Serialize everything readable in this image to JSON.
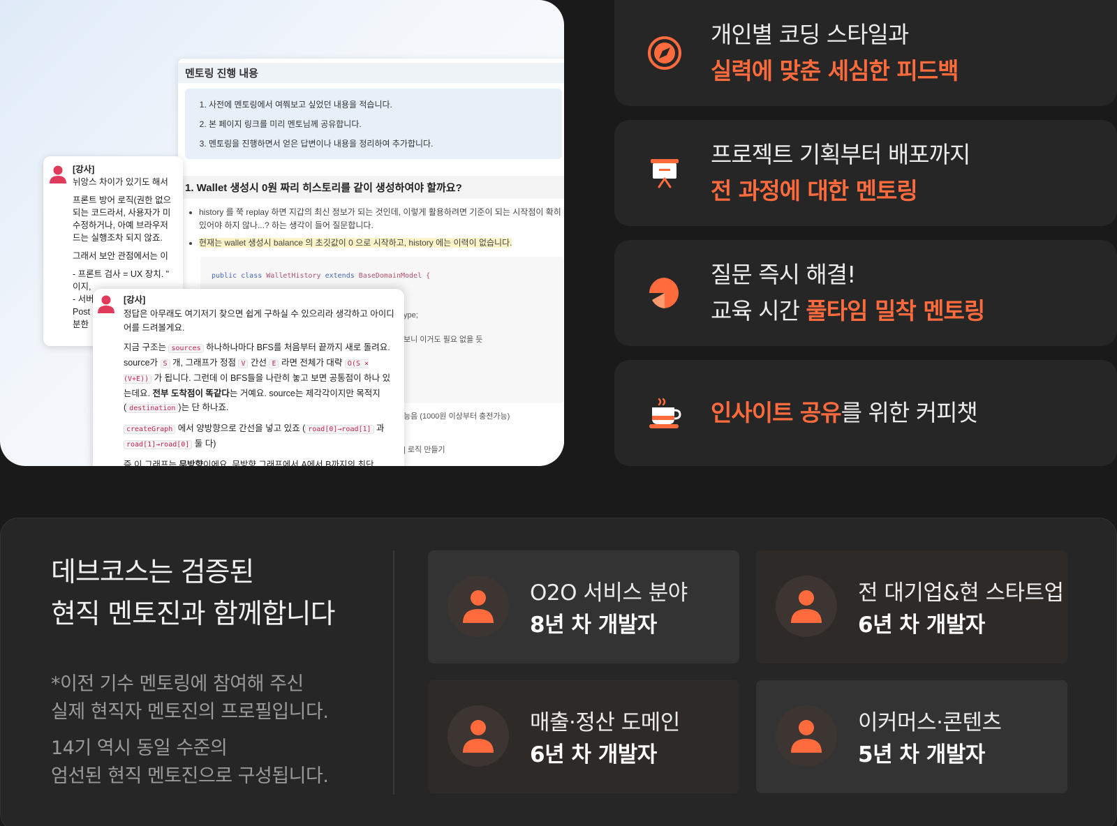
{
  "collage": {
    "doc_title": "멘토링 진행 내용",
    "steps": [
      "사전에 멘토링에서 여쭤보고 싶었던 내용을 적습니다.",
      "본 페이지 링크를 미리 멘토님께 공유합니다.",
      "멘토링을 진행하면서 얻은 답변이나 내용을 정리하여 추가합니다."
    ],
    "question": "1. Wallet 생성시 0원 짜리 히스토리를 같이 생성하여야 할까요?",
    "bullet1": "history 를 쭉 replay 하면 지갑의 최신 정보가 되는 것인데, 이렇게 활용하려면 기준이 되는 시작점이 확히 있어야 하지 않나...? 하는 생각이 들어 질문합니다.",
    "bullet2": "현재는 wallet 생성시 balance 의 초깃값이 0 으로 시작하고, history 에는 이력이 없습니다.",
    "code_kw1": "public class",
    "code_cls1": "WalletHistory",
    "code_kw2": "extends",
    "code_cls2": "BaseDomainModel {",
    "frag1": "ype;",
    "frag2": "보니 이거도 필요 없을 듯",
    "frag3": "능음 (1000원 이상부터 충전가능)",
    "frag4": "| 로직 만들기",
    "card1": {
      "role": "[강사]",
      "lines": [
        "뉘앙스 차이가 있기도 해서",
        "프론트 방어 로직(권한 없으",
        "되는 코드라서, 사용자가 미",
        "수정하거나, 아예 브라우저",
        "드는 실행조차 되지 않죠.",
        "그래서 보안 관점에서는 이",
        "- 프론트 검사 = UX 장치. \"",
        "이지,",
        "- 서버",
        "Post",
        "분한"
      ]
    },
    "card2": {
      "role": "[강사]",
      "intro": "정답은 아무래도 여기저기 찾으면 쉽게 구하실 수 있으리라 생각하고 아이디어를 드려볼게요.",
      "p1_a": "지금 구조는",
      "tok_sources": "sources",
      "p1_b": "하나하나마다 BFS를 처음부터 끝까지 새로 돌려요. source가",
      "tok_s": "S",
      "p1_c": "개, 그래프가 정점",
      "tok_v": "V",
      "p1_d": "간선",
      "tok_e": "E",
      "p1_e": "라면 전체가 대략",
      "tok_o": "O(S × (V+E))",
      "p1_f": "가 됩니다. 그런데 이 BFS들을 나란히 놓고 보면 공통점이 하나 있는데요.",
      "p1_bold": "전부 도착점이 똑같다",
      "p1_g": "는 거예요. source는 제각각이지만 목적지(",
      "tok_dest": "destination",
      "p1_h": ")는 단 하나죠.",
      "tok_cg": "createGraph",
      "p2_a": "에서 양방향으로 간선을 넣고 있죠 (",
      "tok_r1": "road[0]→road[1]",
      "p2_b": "과",
      "tok_r2": "road[1]→road[0]",
      "p2_c": "둘 다)",
      "p3_a": "즉 이 그래프는",
      "p3_bold": "무방향",
      "p3_b": "이에요. 무방향 그래프에서 A에서 B까지의 최단"
    }
  },
  "features": [
    {
      "icon": "compass-icon",
      "line1": "개인별 코딩 스타일과",
      "line2_orange": "실력에 맞춘 세심한 피드백",
      "line2_rest": ""
    },
    {
      "icon": "presentation-board-icon",
      "line1": "프로젝트 기획부터 배포까지",
      "line2_orange": "전 과정에 대한 멘토링",
      "line2_rest": ""
    },
    {
      "icon": "speech-bubble-icon",
      "line1": "질문 즉시 해결!",
      "line2_prefix": "교육 시간 ",
      "line2_orange": "풀타임 밀착 멘토링"
    },
    {
      "icon": "coffee-cup-icon",
      "line_orange": "인사이트 공유",
      "line_rest": "를 위한 커피챗"
    }
  ],
  "bottom": {
    "headline1": "데브코스는 검증된",
    "headline2": "현직 멘토진과 함께합니다",
    "note1a": "*이전 기수 멘토링에 참여해 주신",
    "note1b": "실제 현직자 멘토진의 프로필입니다.",
    "note2a": "14기 역시 동일 수준의",
    "note2b": "엄선된 현직 멘토진으로 구성됩니다.",
    "mentors": [
      {
        "field": "O2O 서비스 분야",
        "career": "8년 차 개발자"
      },
      {
        "field": "전 대기업&현 스타트업",
        "career": "6년 차 개발자"
      },
      {
        "field": "매출·정산 도메인",
        "career": "6년 차 개발자"
      },
      {
        "field": "이커머스·콘텐츠",
        "career": "5년 차 개발자"
      }
    ]
  },
  "colors": {
    "accent": "#ff6b3d",
    "background": "#1a1a1a",
    "card": "#262626"
  }
}
